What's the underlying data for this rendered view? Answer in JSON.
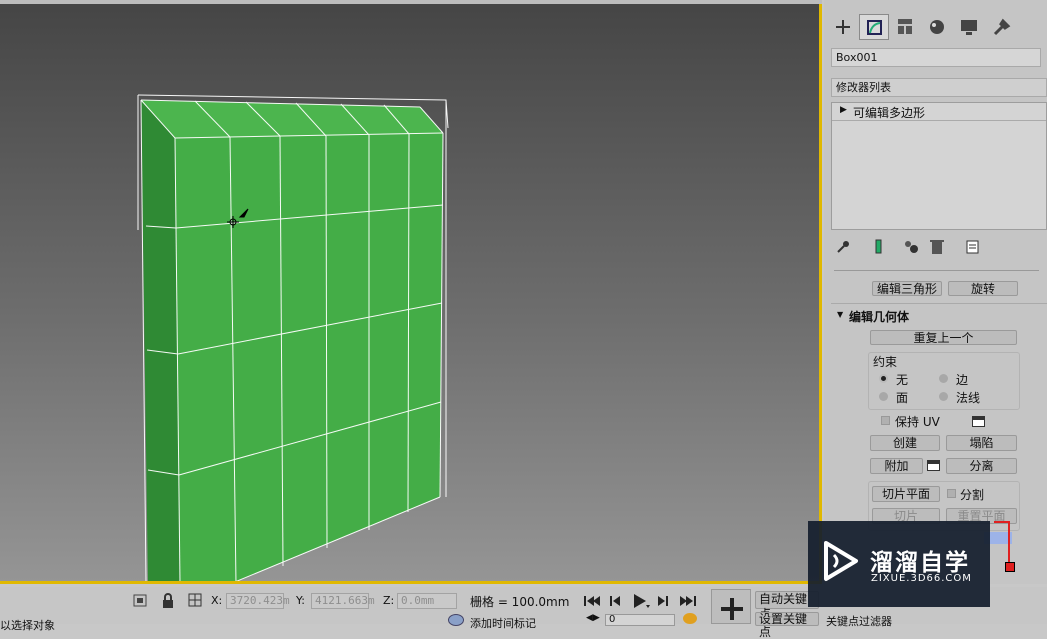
{
  "viewport": {
    "label": "Perspective viewport"
  },
  "command_panel": {
    "tabs": [
      "create",
      "modify",
      "hierarchy",
      "motion",
      "display",
      "utilities"
    ],
    "object_name": "Box001",
    "modifier_list_label": "修改器列表",
    "modifier_stack": [
      {
        "label": "可编辑多边形"
      }
    ],
    "stack_tools": [
      "pin-stack",
      "show-end-result",
      "make-unique",
      "remove-modifier",
      "configure-modifier-sets"
    ],
    "top_buttons": {
      "edit_triangles": "编辑三角形",
      "turn": "旋转"
    },
    "edit_geometry": {
      "title": "编辑几何体",
      "repeat_last": "重复上一个",
      "constraints_label": "约束",
      "constraints": [
        {
          "label": "无",
          "selected": true
        },
        {
          "label": "边",
          "selected": false
        },
        {
          "label": "面",
          "selected": false
        },
        {
          "label": "法线",
          "selected": false
        }
      ],
      "preserve_uv": "保持 UV",
      "create": "创建",
      "collapse": "塌陷",
      "attach": "附加",
      "detach": "分离",
      "slice_plane": "切片平面",
      "split": "分割",
      "slice": "切片",
      "reset_plane": "重置平面"
    }
  },
  "status_bar": {
    "prompt_text": "以选择对象",
    "x_label": "X:",
    "x_value": "3720.423m",
    "y_label": "Y:",
    "y_value": "4121.663m",
    "z_label": "Z:",
    "z_value": "0.0mm",
    "grid_text": "栅格 = 100.0mm",
    "add_time_tag": "添加时间标记",
    "auto_key": "自动关键点",
    "set_key": "设置关键点",
    "key_filters": "关键点过滤器",
    "frame_value": "0"
  },
  "watermark": {
    "brand": "溜溜自学",
    "url": "ZIXUE.3D66.COM"
  },
  "colors": {
    "viewport_border": "#e0b800",
    "mesh_green": "#44b048",
    "mesh_side": "#2f8a34",
    "wire": "#ffffff"
  }
}
